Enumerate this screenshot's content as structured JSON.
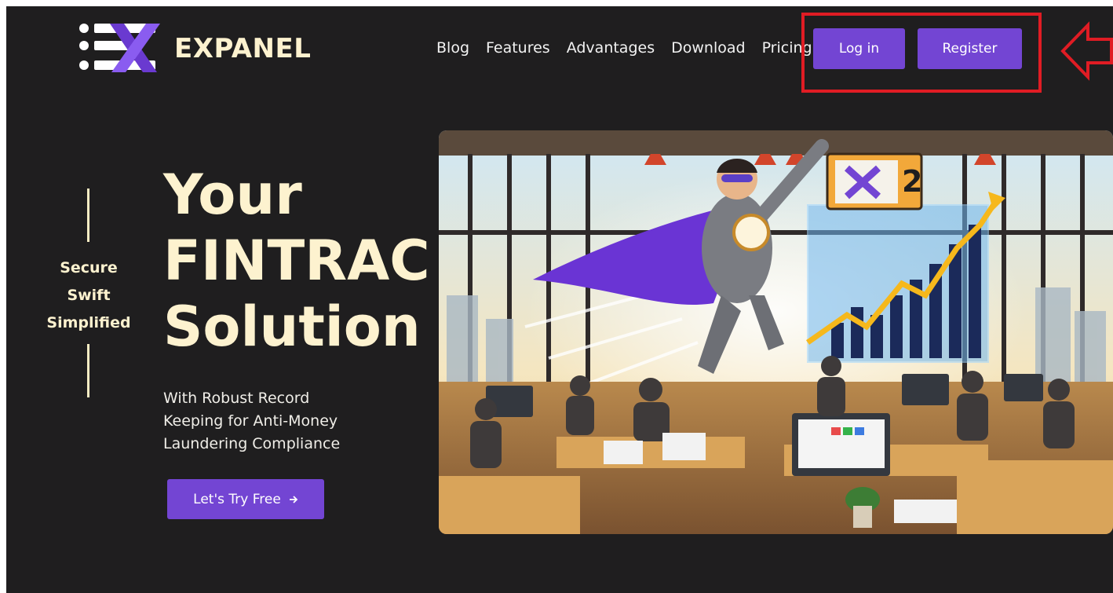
{
  "brand": {
    "name": "EXPANEL",
    "logo_icon": "expanel-x-logo"
  },
  "nav": {
    "items": [
      "Blog",
      "Features",
      "Advantages",
      "Download",
      "Pricing"
    ],
    "login_label": "Log in",
    "register_label": "Register"
  },
  "annotation": {
    "arrow_icon": "red-left-arrow-icon",
    "box_color": "#e01c24"
  },
  "hero": {
    "tagline": [
      "Secure",
      "Swift",
      "Simplified"
    ],
    "headline": [
      "Your",
      "FINTRAC",
      "Solution"
    ],
    "subheading": "With Robust Record Keeping for Anti-Money Laundering Compliance",
    "cta_label": "Let's Try Free",
    "cta_icon": "arrow-right-icon",
    "illustration_chart_label": "2"
  },
  "colors": {
    "background": "#1f1e1f",
    "accent": "#7345d3",
    "headline": "#fdf2cf"
  }
}
